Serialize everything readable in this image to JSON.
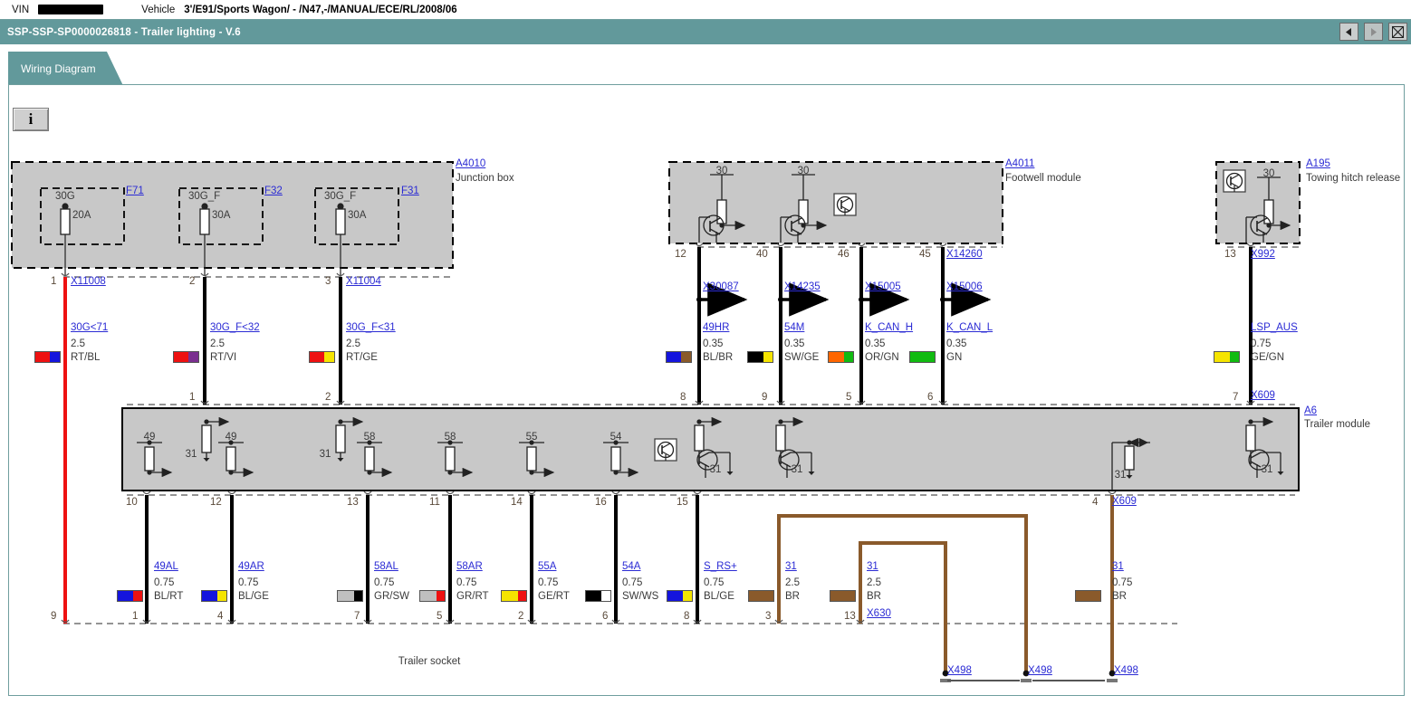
{
  "topbar": {
    "vin_label": "VIN",
    "vin_value": "",
    "vehicle_label": "Vehicle",
    "vehicle_value": "3'/E91/Sports Wagon/ - /N47,-/MANUAL/ECE/RL/2008/06"
  },
  "titlebar": {
    "title": "SSP-SSP-SP0000026818 - Trailer lighting - V.6",
    "back_icon": "triangle-left-icon",
    "forward_icon": "triangle-right-icon",
    "close_icon": "close-x-icon"
  },
  "tabs": [
    {
      "label": "Wiring Diagram",
      "active": true
    }
  ],
  "toolbar": {
    "info_label": "i",
    "info_icon": "info-icon"
  },
  "modules": {
    "junction_box": {
      "code": "A4010",
      "name": "Junction box",
      "fuses": [
        {
          "ref": "F71",
          "circuit": "30G",
          "rating": "20A",
          "pin": "1"
        },
        {
          "ref": "F32",
          "circuit": "30G_F",
          "rating": "30A",
          "pin": "2"
        },
        {
          "ref": "F31",
          "circuit": "30G_F",
          "rating": "30A",
          "pin": "3"
        }
      ],
      "connectors": [
        "X11008",
        "X11004"
      ]
    },
    "footwell_module": {
      "code": "A4011",
      "name": "Footwell module",
      "supply_labels": [
        "30",
        "30"
      ],
      "pins": [
        "12",
        "40",
        "46",
        "45"
      ],
      "connector": "X14260"
    },
    "towing_hitch": {
      "code": "A195",
      "name": "Towing hitch release",
      "supply_label": "30",
      "pin": "13",
      "connector": "X992"
    },
    "trailer_module": {
      "code": "A6",
      "name": "Trailer module",
      "top_pins": [
        "1",
        "2",
        "8",
        "9",
        "5",
        "6",
        "7"
      ],
      "top_connector_right": "X609",
      "bottom_pins": [
        "10",
        "12",
        "13",
        "11",
        "14",
        "16",
        "15",
        "4"
      ],
      "bottom_connector_right": "X609",
      "internal_labels": [
        "49",
        "31",
        "49",
        "31",
        "58",
        "58",
        "55",
        "54",
        "31",
        "31",
        "31",
        "31"
      ]
    },
    "trailer_socket": {
      "name": "Trailer socket",
      "pins": [
        "9",
        "1",
        "4",
        "7",
        "5",
        "2",
        "6",
        "8",
        "3",
        "13"
      ],
      "connector": "X630"
    }
  },
  "wires_upper": [
    {
      "name": "30G<71",
      "size": "2.5",
      "colors": "RT/BL",
      "c1": "#ee1111",
      "c2": "#1414dd",
      "top_pin": "1",
      "conn": "X11008",
      "bot_pin": "9"
    },
    {
      "name": "30G_F<32",
      "size": "2.5",
      "colors": "RT/VI",
      "c1": "#ee1111",
      "c2": "#7a2f8f",
      "top_pin": "2",
      "conn": "",
      "bot_pin": "1"
    },
    {
      "name": "30G_F<31",
      "size": "2.5",
      "colors": "RT/GE",
      "c1": "#ee1111",
      "c2": "#f5e400",
      "top_pin": "3",
      "conn": "X11004",
      "bot_pin": "2"
    },
    {
      "name": "49HR",
      "size": "0.35",
      "colors": "BL/BR",
      "c1": "#1414dd",
      "c2": "#8a5a2b",
      "top_pin": "12",
      "conn": "X30087",
      "bot_pin": "8"
    },
    {
      "name": "54M",
      "size": "0.35",
      "colors": "SW/GE",
      "c1": "#000000",
      "c2": "#f5e400",
      "top_pin": "40",
      "conn": "X14235",
      "bot_pin": "9"
    },
    {
      "name": "K_CAN_H",
      "size": "0.35",
      "colors": "OR/GN",
      "c1": "#ff6600",
      "c2": "#11bb11",
      "top_pin": "46",
      "conn": "X15005",
      "bot_pin": "5"
    },
    {
      "name": "K_CAN_L",
      "size": "0.35",
      "colors": "GN",
      "c1": "#11bb11",
      "c2": "#11bb11",
      "top_pin": "45",
      "conn": "X15006",
      "bot_pin": "6"
    },
    {
      "name": "LSP_AUS",
      "size": "0.75",
      "colors": "GE/GN",
      "c1": "#f5e400",
      "c2": "#11bb11",
      "top_pin": "13",
      "conn": "X992",
      "bot_pin": "7"
    }
  ],
  "wires_lower": [
    {
      "name": "49AL",
      "size": "0.75",
      "colors": "BL/RT",
      "c1": "#1414dd",
      "c2": "#ee1111",
      "top_pin": "10",
      "bot_pin": "1"
    },
    {
      "name": "49AR",
      "size": "0.75",
      "colors": "BL/GE",
      "c1": "#1414dd",
      "c2": "#f5e400",
      "top_pin": "12",
      "bot_pin": "4"
    },
    {
      "name": "58AL",
      "size": "0.75",
      "colors": "GR/SW",
      "c1": "#bfbfbf",
      "c2": "#000000",
      "top_pin": "13",
      "bot_pin": "7"
    },
    {
      "name": "58AR",
      "size": "0.75",
      "colors": "GR/RT",
      "c1": "#bfbfbf",
      "c2": "#ee1111",
      "top_pin": "11",
      "bot_pin": "5"
    },
    {
      "name": "55A",
      "size": "0.75",
      "colors": "GE/RT",
      "c1": "#f5e400",
      "c2": "#ee1111",
      "top_pin": "14",
      "bot_pin": "2"
    },
    {
      "name": "54A",
      "size": "0.75",
      "colors": "SW/WS",
      "c1": "#000000",
      "c2": "#ffffff",
      "top_pin": "16",
      "bot_pin": "6"
    },
    {
      "name": "S_RS+",
      "size": "0.75",
      "colors": "BL/GE",
      "c1": "#1414dd",
      "c2": "#f5e400",
      "top_pin": "15",
      "bot_pin": "8"
    },
    {
      "name": "31",
      "size": "2.5",
      "colors": "BR",
      "c1": "#8a5a2b",
      "c2": "#8a5a2b",
      "top_pin": "",
      "bot_pin": "3"
    },
    {
      "name": "31",
      "size": "2.5",
      "colors": "BR",
      "c1": "#8a5a2b",
      "c2": "#8a5a2b",
      "top_pin": "",
      "bot_pin": "13"
    },
    {
      "name": "31",
      "size": "0.75",
      "colors": "BR",
      "c1": "#8a5a2b",
      "c2": "#8a5a2b",
      "top_pin": "4",
      "bot_pin": ""
    }
  ],
  "grounds": [
    {
      "label": "X498"
    },
    {
      "label": "X498"
    },
    {
      "label": "X498"
    }
  ],
  "colors": {
    "teal": "#62999b",
    "module_fill": "#c8c8c8",
    "link": "#2b2bd4",
    "wire_black": "#000000",
    "wire_red": "#ee1111",
    "wire_brown": "#8a5a2b"
  }
}
